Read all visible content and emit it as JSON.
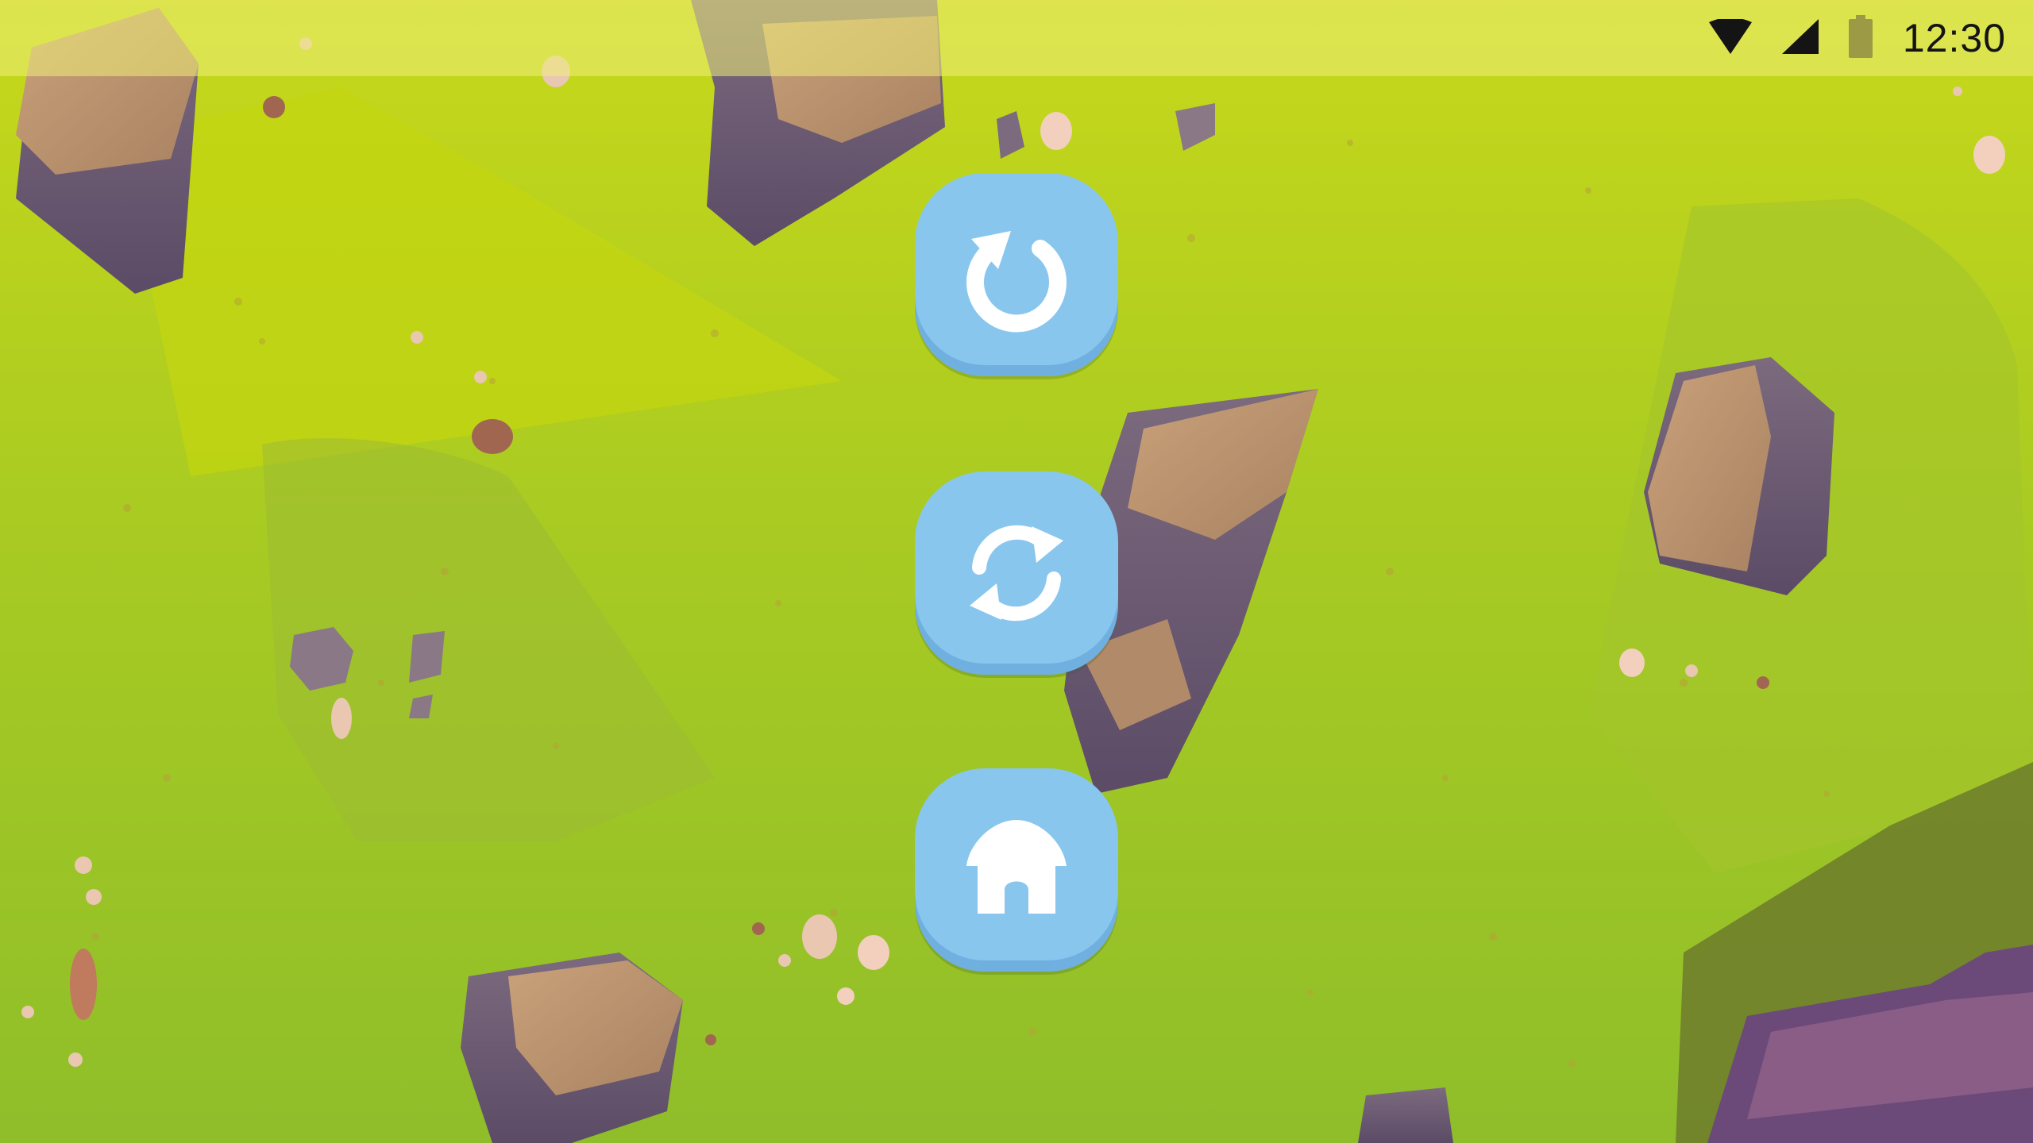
{
  "status_bar": {
    "time": "12:30",
    "icons": [
      "wifi-icon",
      "cellular-signal-icon",
      "battery-icon"
    ]
  },
  "pause_menu": {
    "buttons": [
      {
        "icon": "resume-icon",
        "name": "resume-button"
      },
      {
        "icon": "restart-icon",
        "name": "restart-button"
      },
      {
        "icon": "home-icon",
        "name": "home-button"
      }
    ]
  },
  "colors": {
    "button_fill": "#88c6ee",
    "button_shadow": "#6fb0e0",
    "icon": "#ffffff",
    "grass": "#9fc424",
    "status_bar_tint": "#eeee78"
  }
}
